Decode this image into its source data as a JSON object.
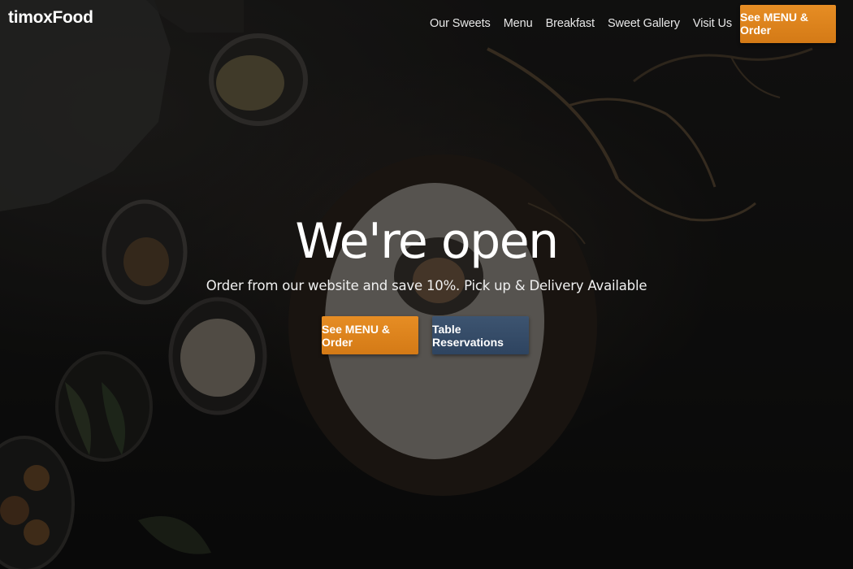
{
  "brand": {
    "name": "timoxFood"
  },
  "nav": {
    "links": [
      {
        "label": "Our Sweets"
      },
      {
        "label": "Menu"
      },
      {
        "label": "Breakfast"
      },
      {
        "label": "Sweet Gallery"
      },
      {
        "label": "Visit Us"
      }
    ],
    "cta_label": "See MENU & Order"
  },
  "hero": {
    "headline": "We're open",
    "subheadline": "Order from our website and save 10%. Pick up & Delivery Available",
    "primary_cta": "See MENU & Order",
    "secondary_cta": "Table Reservations"
  },
  "colors": {
    "accent_orange": "#de8520",
    "secondary_blue": "#354c68",
    "background": "#161615"
  }
}
